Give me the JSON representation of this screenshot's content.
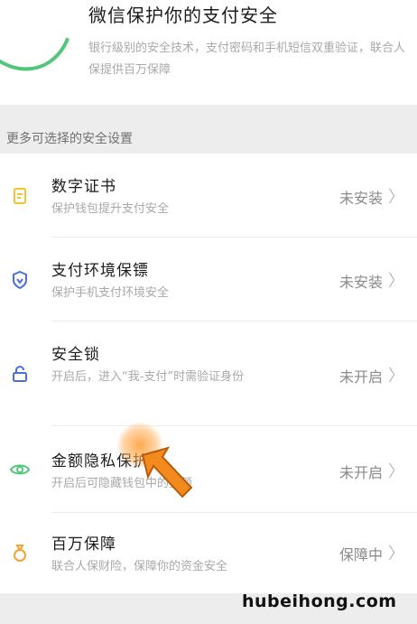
{
  "header": {
    "title": "微信保护你的支付安全",
    "desc": "银行级别的安全技术，支付密码和手机短信双重验证，联合人保提供百万保障"
  },
  "section": {
    "title": "更多可选择的安全设置"
  },
  "items": [
    {
      "title": "数字证书",
      "sub": "保护钱包提升支付安全",
      "status": "未安装",
      "icon": "certificate-icon",
      "color": "#f2c531"
    },
    {
      "title": "支付环境保镖",
      "sub": "保护手机支付环境安全",
      "status": "未安装",
      "icon": "shield-icon",
      "color": "#4a6fd8"
    },
    {
      "title": "安全锁",
      "sub": "开启后，进入“我-支付”时需验证身份",
      "status": "未开启",
      "icon": "lock-icon",
      "color": "#4a6fd8"
    },
    {
      "title": "金额隐私保护",
      "sub": "开启后可隐藏钱包中的金额",
      "status": "未开启",
      "icon": "eye-icon",
      "color": "#52c77a"
    },
    {
      "title": "百万保障",
      "sub": "联合人保财险，保障你的资金安全",
      "status": "保障中",
      "icon": "money-bag-icon",
      "color": "#f2a531"
    }
  ],
  "chevron": "〉",
  "watermark": "hubeihong.com"
}
